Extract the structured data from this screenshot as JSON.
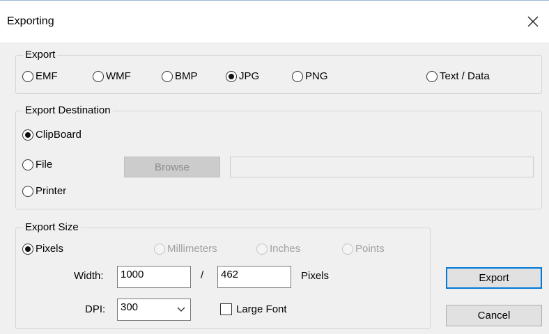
{
  "window": {
    "title": "Exporting",
    "close_icon": "close-icon"
  },
  "export_group": {
    "label": "Export",
    "options": [
      "EMF",
      "WMF",
      "BMP",
      "JPG",
      "PNG",
      "Text / Data"
    ],
    "selected": "JPG"
  },
  "destination_group": {
    "label": "Export Destination",
    "clipboard": "ClipBoard",
    "file": "File",
    "printer": "Printer",
    "browse": "Browse",
    "file_path": "",
    "selected": "ClipBoard"
  },
  "size_group": {
    "label": "Export Size",
    "pixels": "Pixels",
    "millimeters": "Millimeters",
    "inches": "Inches",
    "points": "Points",
    "selected": "Pixels",
    "width_label": "Width:",
    "width_value": "1000",
    "separator": "/",
    "height_value": "462",
    "unit_label": "Pixels",
    "dpi_label": "DPI:",
    "dpi_value": "300",
    "large_font": "Large Font",
    "large_font_checked": false
  },
  "buttons": {
    "export": "Export",
    "cancel": "Cancel"
  }
}
